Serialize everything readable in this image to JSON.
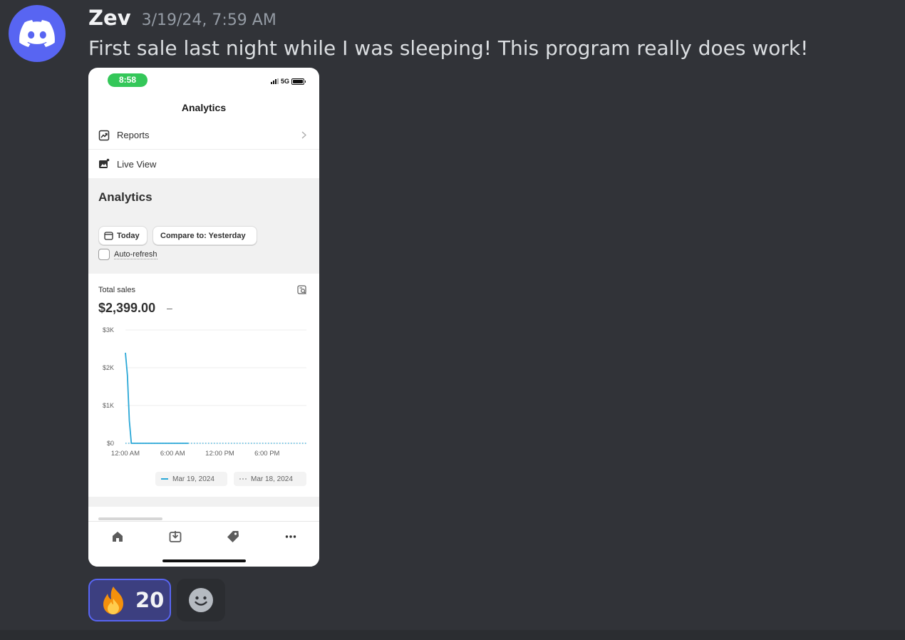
{
  "message": {
    "author": "Zev",
    "timestamp": "3/19/24, 7:59 AM",
    "text": "First sale last night while I was sleeping! This program really does work!",
    "avatar_icon": "discord-logo-icon",
    "avatar_color": "#5865f2"
  },
  "phone": {
    "status": {
      "time": "8:58",
      "network": "5G"
    },
    "nav_title": "Analytics",
    "menu": [
      {
        "label": "Reports",
        "icon": "reports-icon"
      },
      {
        "label": "Live View",
        "icon": "live-view-icon"
      }
    ],
    "panel": {
      "title": "Analytics",
      "today_label": "Today",
      "compare_label": "Compare to: Yesterday",
      "autorefresh_label": "Auto-refresh"
    },
    "card": {
      "label": "Total sales",
      "value": "$2,399.00",
      "change": "–"
    },
    "legend": [
      {
        "label": "Mar 19, 2024",
        "color": "#2ba8d7",
        "style": "solid"
      },
      {
        "label": "Mar 18, 2024",
        "color": "#b5b5b5",
        "style": "dotted"
      }
    ],
    "tabs": [
      "home-icon",
      "orders-icon",
      "products-icon",
      "more-icon"
    ]
  },
  "chart_data": {
    "type": "line",
    "title": "Total sales",
    "ylabel": "",
    "xlabel": "",
    "ylim": [
      0,
      3000
    ],
    "y_ticks": [
      {
        "value": 3000,
        "label": "$3K"
      },
      {
        "value": 2000,
        "label": "$2K"
      },
      {
        "value": 1000,
        "label": "$1K"
      },
      {
        "value": 0,
        "label": "$0"
      }
    ],
    "x_ticks": [
      {
        "hour": 0,
        "label": "12:00 AM"
      },
      {
        "hour": 6,
        "label": "6:00 AM"
      },
      {
        "hour": 12,
        "label": "12:00 PM"
      },
      {
        "hour": 18,
        "label": "6:00 PM"
      }
    ],
    "xlim": [
      0,
      23
    ],
    "series": [
      {
        "name": "Mar 19, 2024",
        "style": "solid",
        "color": "#2ba8d7",
        "points": [
          [
            0,
            2399
          ],
          [
            0.25,
            1800
          ],
          [
            0.5,
            600
          ],
          [
            0.75,
            0
          ],
          [
            1,
            0
          ],
          [
            2,
            0
          ],
          [
            3,
            0
          ],
          [
            4,
            0
          ],
          [
            5,
            0
          ],
          [
            6,
            0
          ],
          [
            7,
            0
          ],
          [
            8,
            0
          ]
        ]
      },
      {
        "name": "Mar 18, 2024",
        "style": "dotted",
        "color": "#2ba8d7",
        "points": [
          [
            0,
            0
          ],
          [
            4,
            0
          ],
          [
            8,
            0
          ],
          [
            12,
            0
          ],
          [
            16,
            0
          ],
          [
            20,
            0
          ],
          [
            23,
            0
          ]
        ]
      }
    ]
  },
  "reaction": {
    "emoji": "fire-emoji-icon",
    "count": "20"
  },
  "add_reaction_icon": "add-reaction-smiley-icon"
}
